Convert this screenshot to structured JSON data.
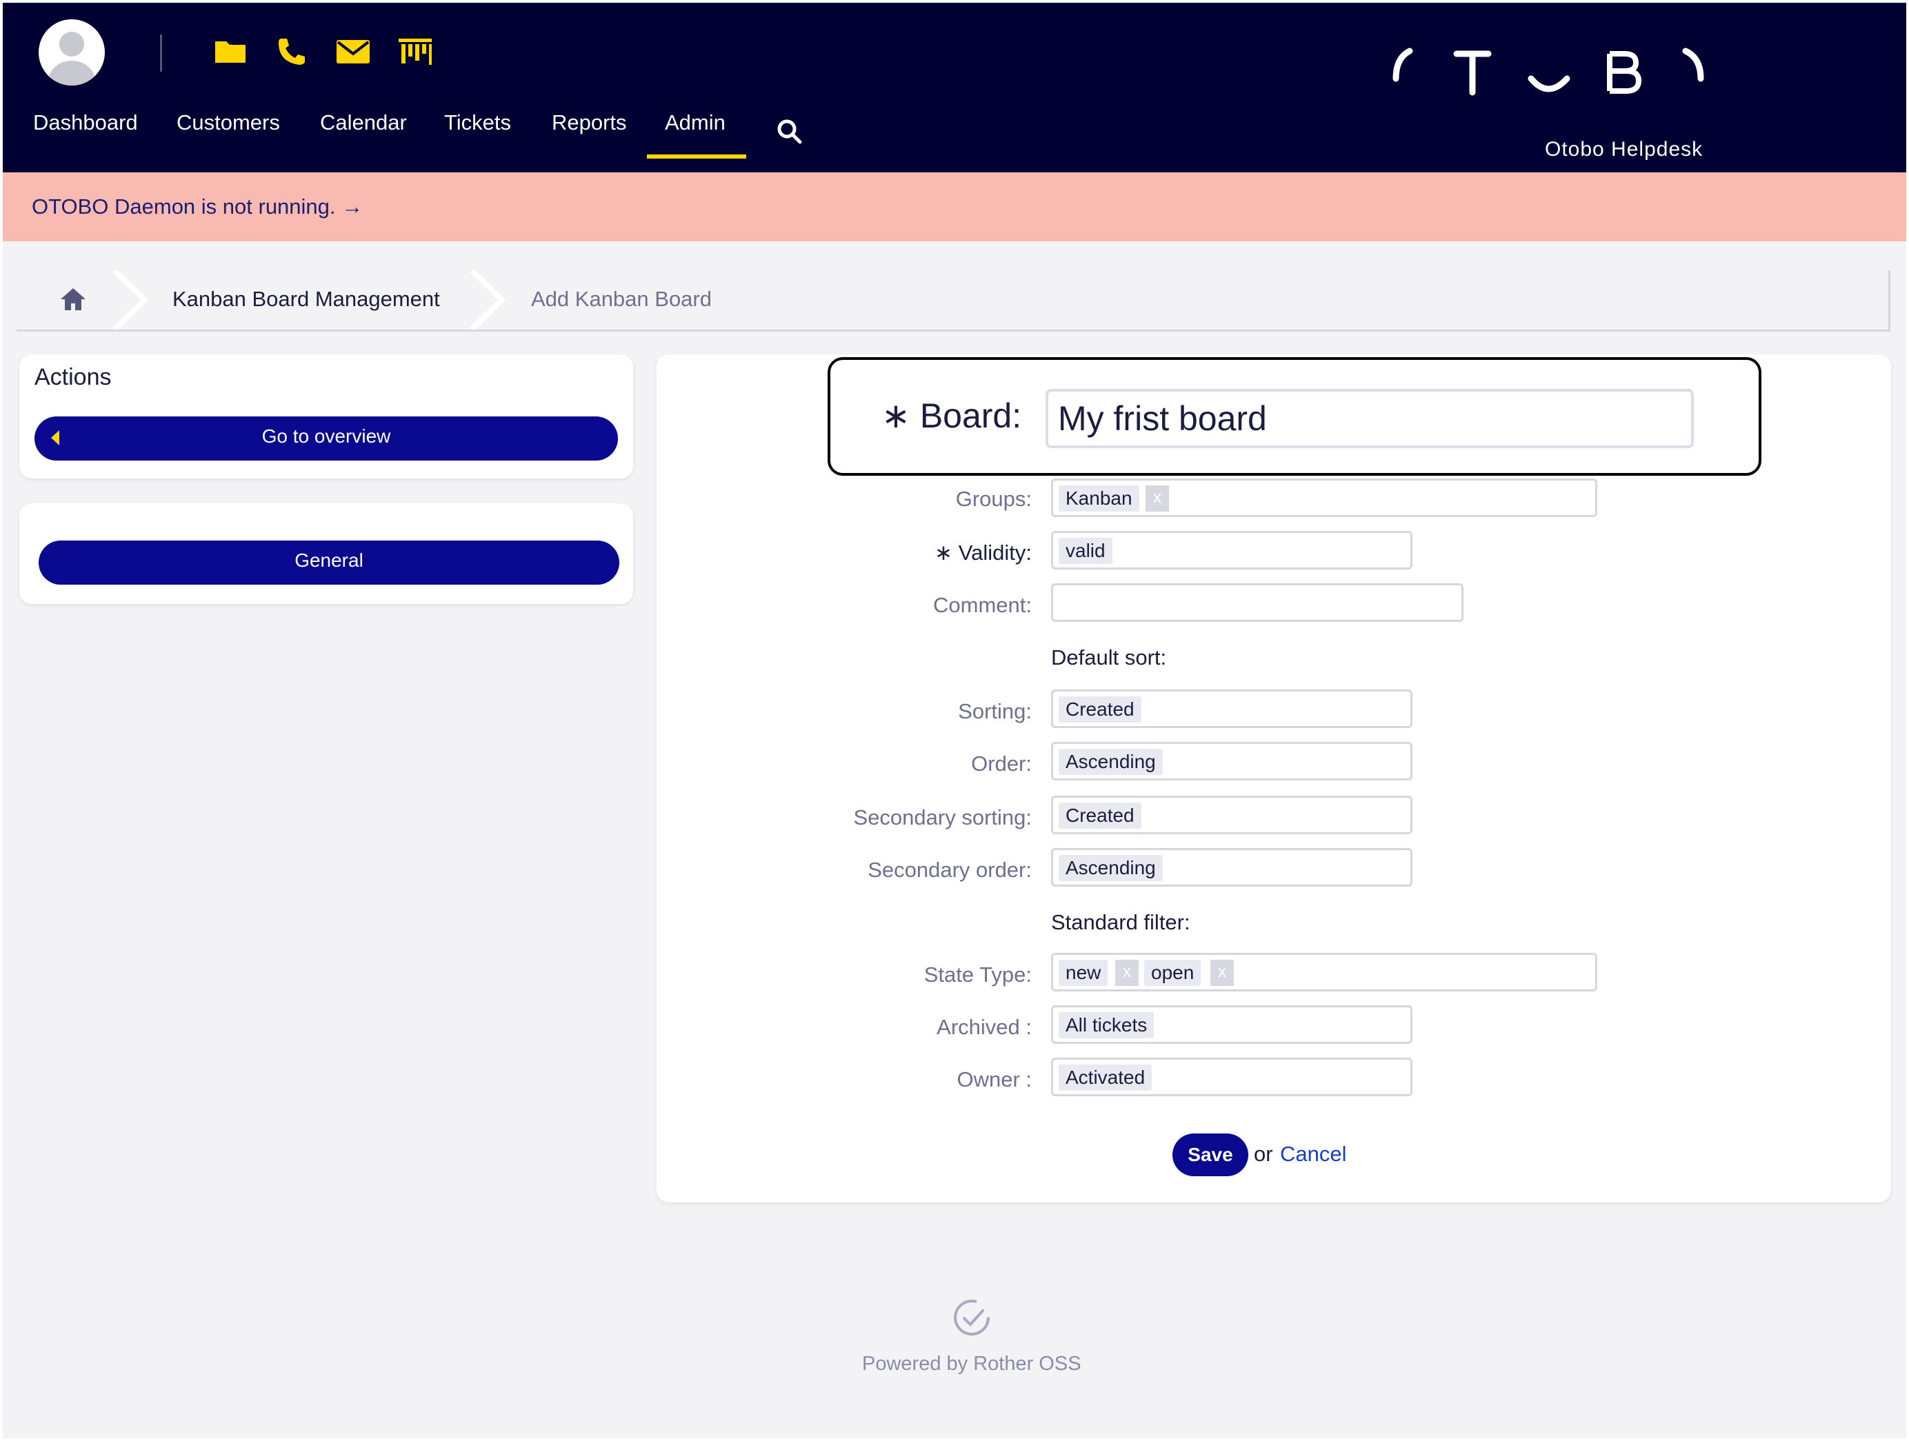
{
  "header": {
    "nav": [
      "Dashboard",
      "Customers",
      "Calendar",
      "Tickets",
      "Reports",
      "Admin"
    ],
    "active_nav": "Admin",
    "brand_logo_text": "OTOBO",
    "brand_subtitle": "Otobo Helpdesk",
    "quick_icons": [
      "folder-icon",
      "phone-icon",
      "email-icon",
      "kanban-icon"
    ]
  },
  "warning": {
    "text": "OTOBO Daemon is not running. →"
  },
  "breadcrumb": {
    "items": [
      "Kanban Board Management",
      "Add Kanban Board"
    ]
  },
  "sidebar": {
    "actions_title": "Actions",
    "overview_button": "Go to overview",
    "general_button": "General"
  },
  "form": {
    "board": {
      "label": "Board:",
      "required_mark": "∗",
      "value": "My frist board"
    },
    "groups": {
      "label": "Groups:",
      "tags": [
        "Kanban"
      ]
    },
    "validity": {
      "label": "Validity:",
      "required_mark": "∗",
      "value": "valid"
    },
    "comment": {
      "label": "Comment:",
      "value": ""
    },
    "default_sort_heading": "Default sort:",
    "sorting": {
      "label": "Sorting:",
      "value": "Created"
    },
    "order": {
      "label": "Order:",
      "value": "Ascending"
    },
    "secondary_sorting": {
      "label": "Secondary sorting:",
      "value": "Created"
    },
    "secondary_order": {
      "label": "Secondary order:",
      "value": "Ascending"
    },
    "standard_filter_heading": "Standard filter:",
    "state_type": {
      "label": "State Type:",
      "tags": [
        "new",
        "open"
      ]
    },
    "archived": {
      "label": "Archived :",
      "value": "All tickets"
    },
    "owner": {
      "label": "Owner :",
      "value": "Activated"
    },
    "save_label": "Save",
    "or_text": "or",
    "cancel_label": "Cancel",
    "tag_remove": "x"
  },
  "footer": {
    "text": "Powered by Rother OSS"
  },
  "colors": {
    "header_bg": "#000033",
    "accent_yellow": "#ffd600",
    "button_blue": "#0a0a90",
    "warning_bg": "#f9bbb1",
    "link_blue": "#1a3cc8"
  }
}
